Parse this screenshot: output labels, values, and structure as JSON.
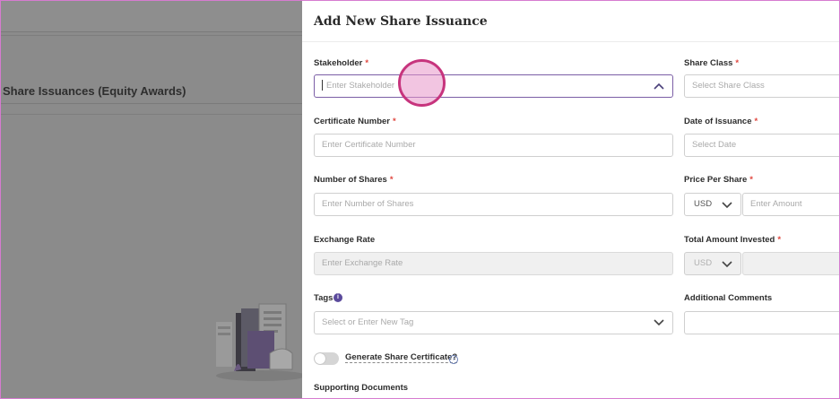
{
  "background": {
    "section_title": "Share Issuances (Equity Awards)"
  },
  "drawer": {
    "title": "Add New Share Issuance",
    "fields": {
      "stakeholder": {
        "label": "Stakeholder",
        "placeholder": "Enter Stakeholder",
        "required": "*"
      },
      "share_class": {
        "label": "Share Class",
        "placeholder": "Select Share Class",
        "required": "*"
      },
      "certificate_number": {
        "label": "Certificate Number",
        "placeholder": "Enter Certificate Number",
        "required": "*"
      },
      "date_of_issuance": {
        "label": "Date of Issuance",
        "placeholder": "Select Date",
        "required": "*"
      },
      "number_of_shares": {
        "label": "Number of Shares",
        "placeholder": "Enter Number of Shares",
        "required": "*"
      },
      "price_per_share": {
        "label": "Price Per Share",
        "currency": "USD",
        "placeholder": "Enter Amount",
        "required": "*"
      },
      "exchange_rate": {
        "label": "Exchange Rate",
        "placeholder": "Enter Exchange Rate"
      },
      "total_amount_invested": {
        "label": "Total Amount Invested",
        "currency": "USD",
        "required": "*"
      },
      "tags": {
        "label": "Tags",
        "placeholder": "Select or Enter New Tag",
        "info": "i"
      },
      "additional_comments": {
        "label": "Additional Comments"
      },
      "generate_certificate": {
        "label": "Generate Share Certificate?",
        "help": "i"
      },
      "supporting_documents": {
        "label": "Supporting Documents"
      }
    }
  },
  "colors": {
    "accent": "#5b4a9c",
    "required": "#e0473f",
    "overlay": "#8b8b8b",
    "cursor_ring": "#c7347d"
  }
}
